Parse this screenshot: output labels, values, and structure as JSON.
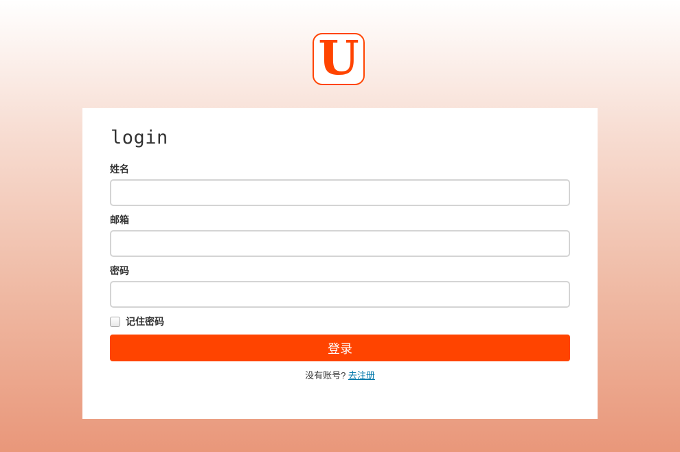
{
  "logo": {
    "letter": "U",
    "color": "#ff4400"
  },
  "form": {
    "title": "login",
    "fields": [
      {
        "label": "姓名",
        "value": "",
        "placeholder": ""
      },
      {
        "label": "邮箱",
        "value": "",
        "placeholder": ""
      },
      {
        "label": "密码",
        "value": "",
        "placeholder": ""
      }
    ],
    "remember_label": "记住密码",
    "remember_checked": false,
    "submit_label": "登录",
    "submit_color": "#ff4400",
    "no_account_text": "没有账号?",
    "register_link": "去注册",
    "link_color": "#0077aa"
  }
}
